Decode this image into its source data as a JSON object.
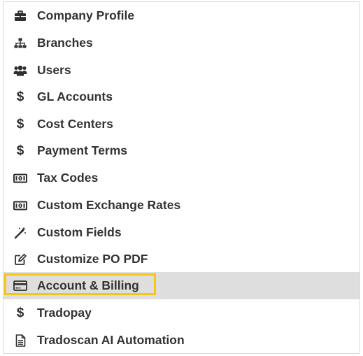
{
  "menu": {
    "items": [
      {
        "label": "Company Profile",
        "icon": "briefcase-icon"
      },
      {
        "label": "Branches",
        "icon": "sitemap-icon"
      },
      {
        "label": "Users",
        "icon": "users-icon"
      },
      {
        "label": "GL Accounts",
        "icon": "dollar-icon"
      },
      {
        "label": "Cost Centers",
        "icon": "dollar-icon"
      },
      {
        "label": "Payment Terms",
        "icon": "dollar-icon"
      },
      {
        "label": "Tax Codes",
        "icon": "money-bill-icon"
      },
      {
        "label": "Custom Exchange Rates",
        "icon": "money-bill-icon"
      },
      {
        "label": "Custom Fields",
        "icon": "magic-wand-icon"
      },
      {
        "label": "Customize PO PDF",
        "icon": "edit-icon"
      },
      {
        "label": "Account & Billing",
        "icon": "credit-card-icon",
        "active": true
      },
      {
        "label": "Tradopay",
        "icon": "dollar-icon"
      },
      {
        "label": "Tradoscan AI Automation",
        "icon": "file-text-icon"
      }
    ]
  },
  "colors": {
    "active_background": "#dedede",
    "highlight_border": "#f5c518",
    "text": "#333333"
  }
}
